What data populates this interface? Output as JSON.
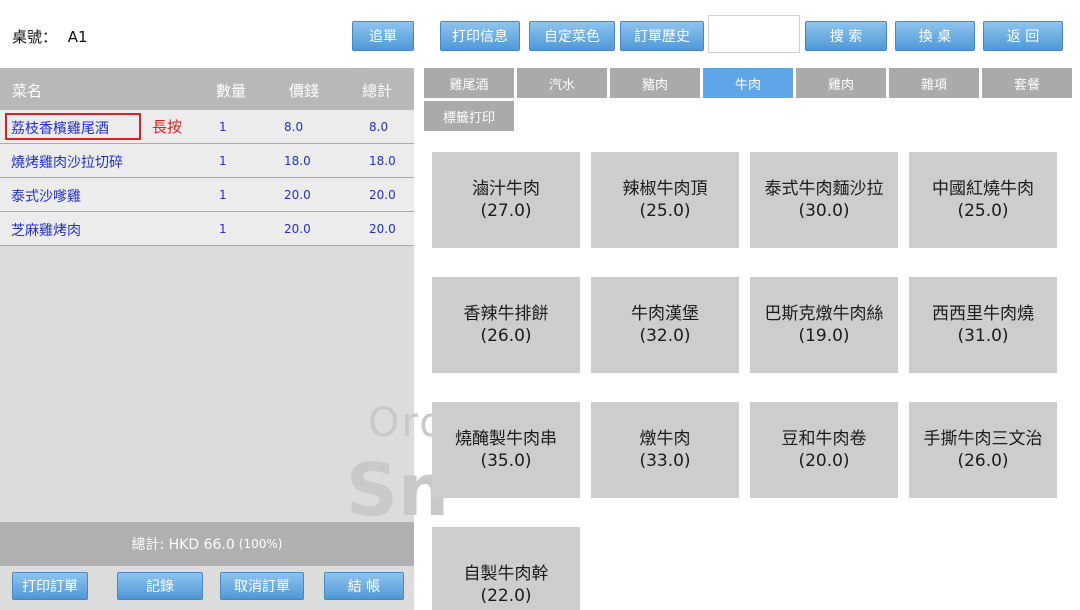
{
  "header": {
    "table_label": "桌號：",
    "table_value": "A1",
    "buttons": {
      "add_order": "追單",
      "print_info": "打印信息",
      "custom_dish": "自定菜色",
      "order_history": "訂單歷史",
      "search": "搜 索",
      "change_table": "換 桌",
      "back": "返 回"
    },
    "search_value": ""
  },
  "order": {
    "columns": {
      "name": "菜名",
      "qty": "數量",
      "price": "價錢",
      "total": "總計"
    },
    "rows": [
      {
        "name": "荔枝香檳雞尾酒",
        "qty": "1",
        "price": "8.0",
        "total": "8.0"
      },
      {
        "name": "燒烤雞肉沙拉切碎",
        "qty": "1",
        "price": "18.0",
        "total": "18.0"
      },
      {
        "name": "泰式沙嗲雞",
        "qty": "1",
        "price": "20.0",
        "total": "20.0"
      },
      {
        "name": "芝麻雞烤肉",
        "qty": "1",
        "price": "20.0",
        "total": "20.0"
      }
    ],
    "long_press_hint": "長按",
    "watermark_line1": "Ord",
    "watermark_line2": "Sn",
    "total_text": "總計:  HKD 66.0",
    "total_pct": "(100%)"
  },
  "bottom": {
    "print_order": "打印訂單",
    "records": "記錄",
    "cancel_order": "取消訂單",
    "checkout": "結 帳"
  },
  "categories": [
    "雞尾酒",
    "汽水",
    "豬肉",
    "牛肉",
    "雞肉",
    "雜項",
    "套餐",
    "標籤打印"
  ],
  "active_category": "牛肉",
  "items": [
    {
      "name": "滷汁牛肉",
      "price": "(27.0)"
    },
    {
      "name": "辣椒牛肉頂",
      "price": "(25.0)"
    },
    {
      "name": "泰式牛肉麵沙拉",
      "price": "(30.0)"
    },
    {
      "name": "中國紅燒牛肉",
      "price": "(25.0)"
    },
    {
      "name": "香辣牛排餅",
      "price": "(26.0)"
    },
    {
      "name": "牛肉漢堡",
      "price": "(32.0)"
    },
    {
      "name": "巴斯克燉牛肉絲",
      "price": "(19.0)"
    },
    {
      "name": "西西里牛肉燒",
      "price": "(31.0)"
    },
    {
      "name": "燒醃製牛肉串",
      "price": "(35.0)"
    },
    {
      "name": "燉牛肉",
      "price": "(33.0)"
    },
    {
      "name": "豆和牛肉卷",
      "price": "(20.0)"
    },
    {
      "name": "手撕牛肉三文治",
      "price": "(26.0)"
    },
    {
      "name": "自製牛肉幹",
      "price": "(22.0)"
    }
  ],
  "colors": {
    "accent_blue": "#5fa6e8",
    "item_text_blue": "#2030c8",
    "highlight_red": "#e02020",
    "category_gray": "#aaaaaa"
  }
}
